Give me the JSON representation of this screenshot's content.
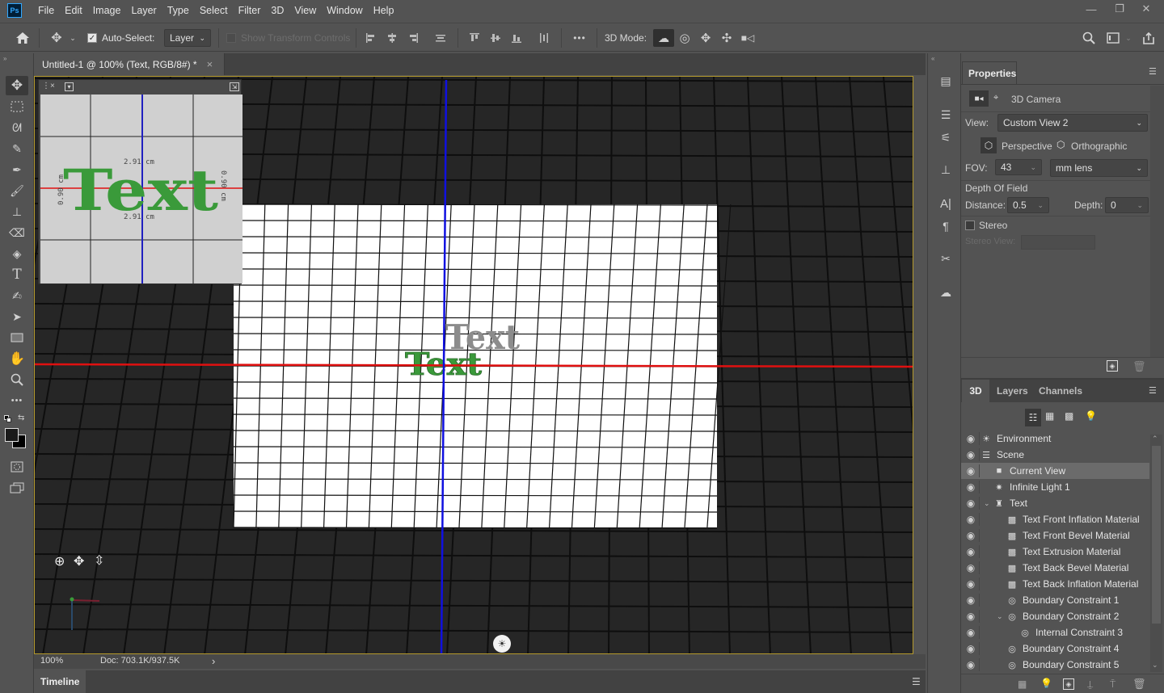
{
  "app": {
    "logo": "Ps",
    "name": "Photoshop"
  },
  "menu": [
    "File",
    "Edit",
    "Image",
    "Layer",
    "Type",
    "Select",
    "Filter",
    "3D",
    "View",
    "Window",
    "Help"
  ],
  "window_controls": {
    "minimize": "—",
    "restore": "❐",
    "close": "✕"
  },
  "options_bar": {
    "auto_select_label": "Auto-Select:",
    "auto_select_checked": true,
    "auto_select_target": "Layer",
    "show_transform_label": "Show Transform Controls",
    "show_transform_checked": false,
    "more_label": "•••",
    "mode_3d_label": "3D Mode:"
  },
  "document": {
    "tab_title": "Untitled-1 @ 100% (Text, RGB/8#) *",
    "close_glyph": "×",
    "zoom": "100%",
    "doc_size": "Doc: 703.1K/937.5K",
    "status_arrow": "›"
  },
  "secondary_view": {
    "text": "Text",
    "dim_top": "2.91 cm",
    "dim_bottom": "2.91 cm",
    "dim_left": "0.90 cm",
    "dim_right": "0.90 cm"
  },
  "scene_text": {
    "front": "Text",
    "back": "Text"
  },
  "timeline": {
    "label": "Timeline"
  },
  "properties": {
    "tab": "Properties",
    "header": "3D Camera",
    "view_label": "View:",
    "view_value": "Custom View 2",
    "perspective_label": "Perspective",
    "orthographic_label": "Orthographic",
    "fov_label": "FOV:",
    "fov_value": "43",
    "lens_value": "mm lens",
    "dof_label": "Depth Of Field",
    "distance_label": "Distance:",
    "distance_value": "0.5",
    "depth_label": "Depth:",
    "depth_value": "0",
    "stereo_label": "Stereo",
    "stereo_checked": false,
    "stereo_view_label": "Stereo View:"
  },
  "panel_3d": {
    "tabs": [
      "3D",
      "Layers",
      "Channels"
    ],
    "active_tab": "3D",
    "items": [
      {
        "label": "Environment",
        "icon": "environment-icon",
        "glyph": "☀",
        "indent": 0,
        "eye": true
      },
      {
        "label": "Scene",
        "icon": "scene-icon",
        "glyph": "☰",
        "indent": 0,
        "eye": true
      },
      {
        "label": "Current View",
        "icon": "camera-icon",
        "glyph": "■",
        "indent": 1,
        "eye": true,
        "selected": true
      },
      {
        "label": "Infinite Light 1",
        "icon": "light-icon",
        "glyph": "✷",
        "indent": 1,
        "eye": true
      },
      {
        "label": "Text",
        "icon": "mesh-icon",
        "glyph": "♜",
        "indent": 1,
        "eye": true,
        "expanded": true
      },
      {
        "label": "Text Front Inflation Material",
        "icon": "material-icon",
        "glyph": "▩",
        "indent": 2,
        "eye": true
      },
      {
        "label": "Text Front Bevel Material",
        "icon": "material-icon",
        "glyph": "▩",
        "indent": 2,
        "eye": true
      },
      {
        "label": "Text Extrusion Material",
        "icon": "material-icon",
        "glyph": "▩",
        "indent": 2,
        "eye": true
      },
      {
        "label": "Text Back Bevel Material",
        "icon": "material-icon",
        "glyph": "▩",
        "indent": 2,
        "eye": true
      },
      {
        "label": "Text Back Inflation Material",
        "icon": "material-icon",
        "glyph": "▩",
        "indent": 2,
        "eye": true
      },
      {
        "label": "Boundary Constraint 1",
        "icon": "constraint-icon",
        "glyph": "◎",
        "indent": 2,
        "eye": true
      },
      {
        "label": "Boundary Constraint 2",
        "icon": "constraint-icon",
        "glyph": "◎",
        "indent": 2,
        "eye": true,
        "expanded": true
      },
      {
        "label": "Internal Constraint 3",
        "icon": "constraint-icon",
        "glyph": "◎",
        "indent": 3,
        "eye": true
      },
      {
        "label": "Boundary Constraint 4",
        "icon": "constraint-icon",
        "glyph": "◎",
        "indent": 2,
        "eye": true
      },
      {
        "label": "Boundary Constraint 5",
        "icon": "constraint-icon",
        "glyph": "◎",
        "indent": 2,
        "eye": true
      }
    ]
  },
  "colors": {
    "accent_frame": "#b59a2c",
    "x_axis": "#e01010",
    "y_axis": "#1010e0",
    "text_green": "#3a9a3a"
  }
}
